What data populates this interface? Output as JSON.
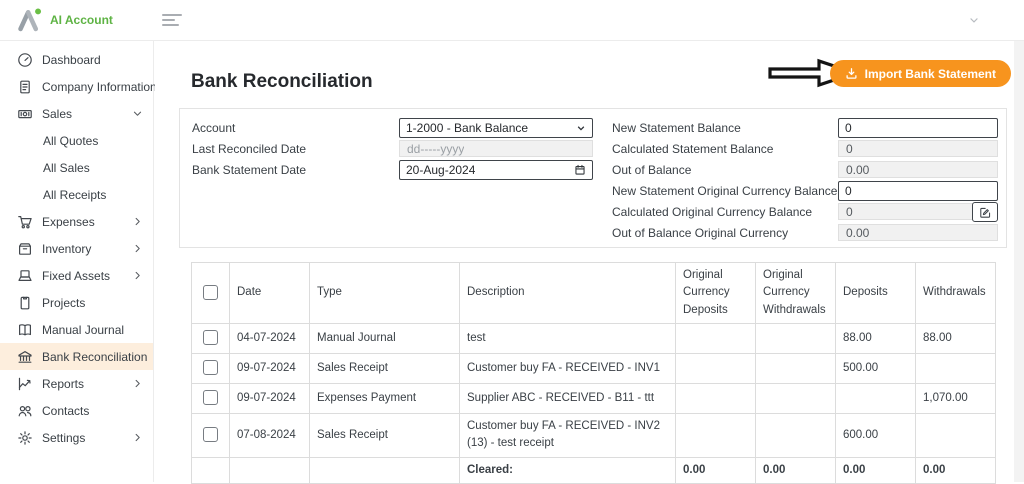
{
  "header": {
    "brand": "AI Account"
  },
  "sidebar": {
    "items": [
      {
        "label": "Dashboard",
        "icon": "dashboard"
      },
      {
        "label": "Company Information",
        "icon": "company-info"
      },
      {
        "label": "Sales",
        "icon": "sales",
        "chevron": "down"
      },
      {
        "label": "All Quotes",
        "child": true
      },
      {
        "label": "All Sales",
        "child": true
      },
      {
        "label": "All Receipts",
        "child": true
      },
      {
        "label": "Expenses",
        "icon": "expenses",
        "chevron": "right"
      },
      {
        "label": "Inventory",
        "icon": "inventory",
        "chevron": "right"
      },
      {
        "label": "Fixed Assets",
        "icon": "fixed-assets",
        "chevron": "right"
      },
      {
        "label": "Projects",
        "icon": "projects"
      },
      {
        "label": "Manual Journal",
        "icon": "manual-journal"
      },
      {
        "label": "Bank Reconciliation",
        "icon": "bank",
        "active": true
      },
      {
        "label": "Reports",
        "icon": "reports",
        "chevron": "right"
      },
      {
        "label": "Contacts",
        "icon": "contacts"
      },
      {
        "label": "Settings",
        "icon": "settings",
        "chevron": "right"
      }
    ]
  },
  "page": {
    "title": "Bank Reconciliation",
    "import_button_label": "Import Bank Statement"
  },
  "form": {
    "left": [
      {
        "label": "Account",
        "value": "1-2000 - Bank Balance",
        "control": "select"
      },
      {
        "label": "Last Reconciled Date",
        "value": "dd-----yyyy",
        "control": "disabled",
        "placeholder": true
      },
      {
        "label": "Bank Statement Date",
        "value": "20-Aug-2024",
        "control": "date"
      }
    ],
    "right": [
      {
        "label": "New Statement Balance",
        "value": "0",
        "control": "input"
      },
      {
        "label": "Calculated Statement Balance",
        "value": "0",
        "control": "disabled"
      },
      {
        "label": "Out of Balance",
        "value": "0.00",
        "control": "disabled"
      },
      {
        "label": "New Statement Original Currency Balance",
        "value": "0",
        "control": "input"
      },
      {
        "label": "Calculated Original Currency Balance",
        "value": "0",
        "control": "disabled",
        "edit_button": true
      },
      {
        "label": "Out of Balance Original Currency",
        "value": "0.00",
        "control": "disabled"
      }
    ]
  },
  "table": {
    "headers": [
      "Date",
      "Type",
      "Description",
      "Original Currency Deposits",
      "Original Currency Withdrawals",
      "Deposits",
      "Withdrawals"
    ],
    "rows": [
      [
        "04-07-2024",
        "Manual Journal",
        "test",
        "",
        "",
        "88.00",
        "88.00"
      ],
      [
        "09-07-2024",
        "Sales Receipt",
        "Customer buy FA - RECEIVED - INV1",
        "",
        "",
        "500.00",
        ""
      ],
      [
        "09-07-2024",
        "Expenses Payment",
        "Supplier ABC - RECEIVED - B11 - ttt",
        "",
        "",
        "",
        "1,070.00"
      ],
      [
        "07-08-2024",
        "Sales Receipt",
        "Customer buy FA - RECEIVED - INV2 (13) - test receipt",
        "",
        "",
        "600.00",
        ""
      ]
    ],
    "footer": [
      "",
      "",
      "Cleared:",
      "0.00",
      "0.00",
      "0.00",
      "0.00"
    ]
  },
  "colors": {
    "accent_orange": "#f7941e",
    "brand_green": "#5eb344",
    "active_item_bg": "#fdeedd",
    "border": "#e0e0e0",
    "text": "#3a4046"
  }
}
